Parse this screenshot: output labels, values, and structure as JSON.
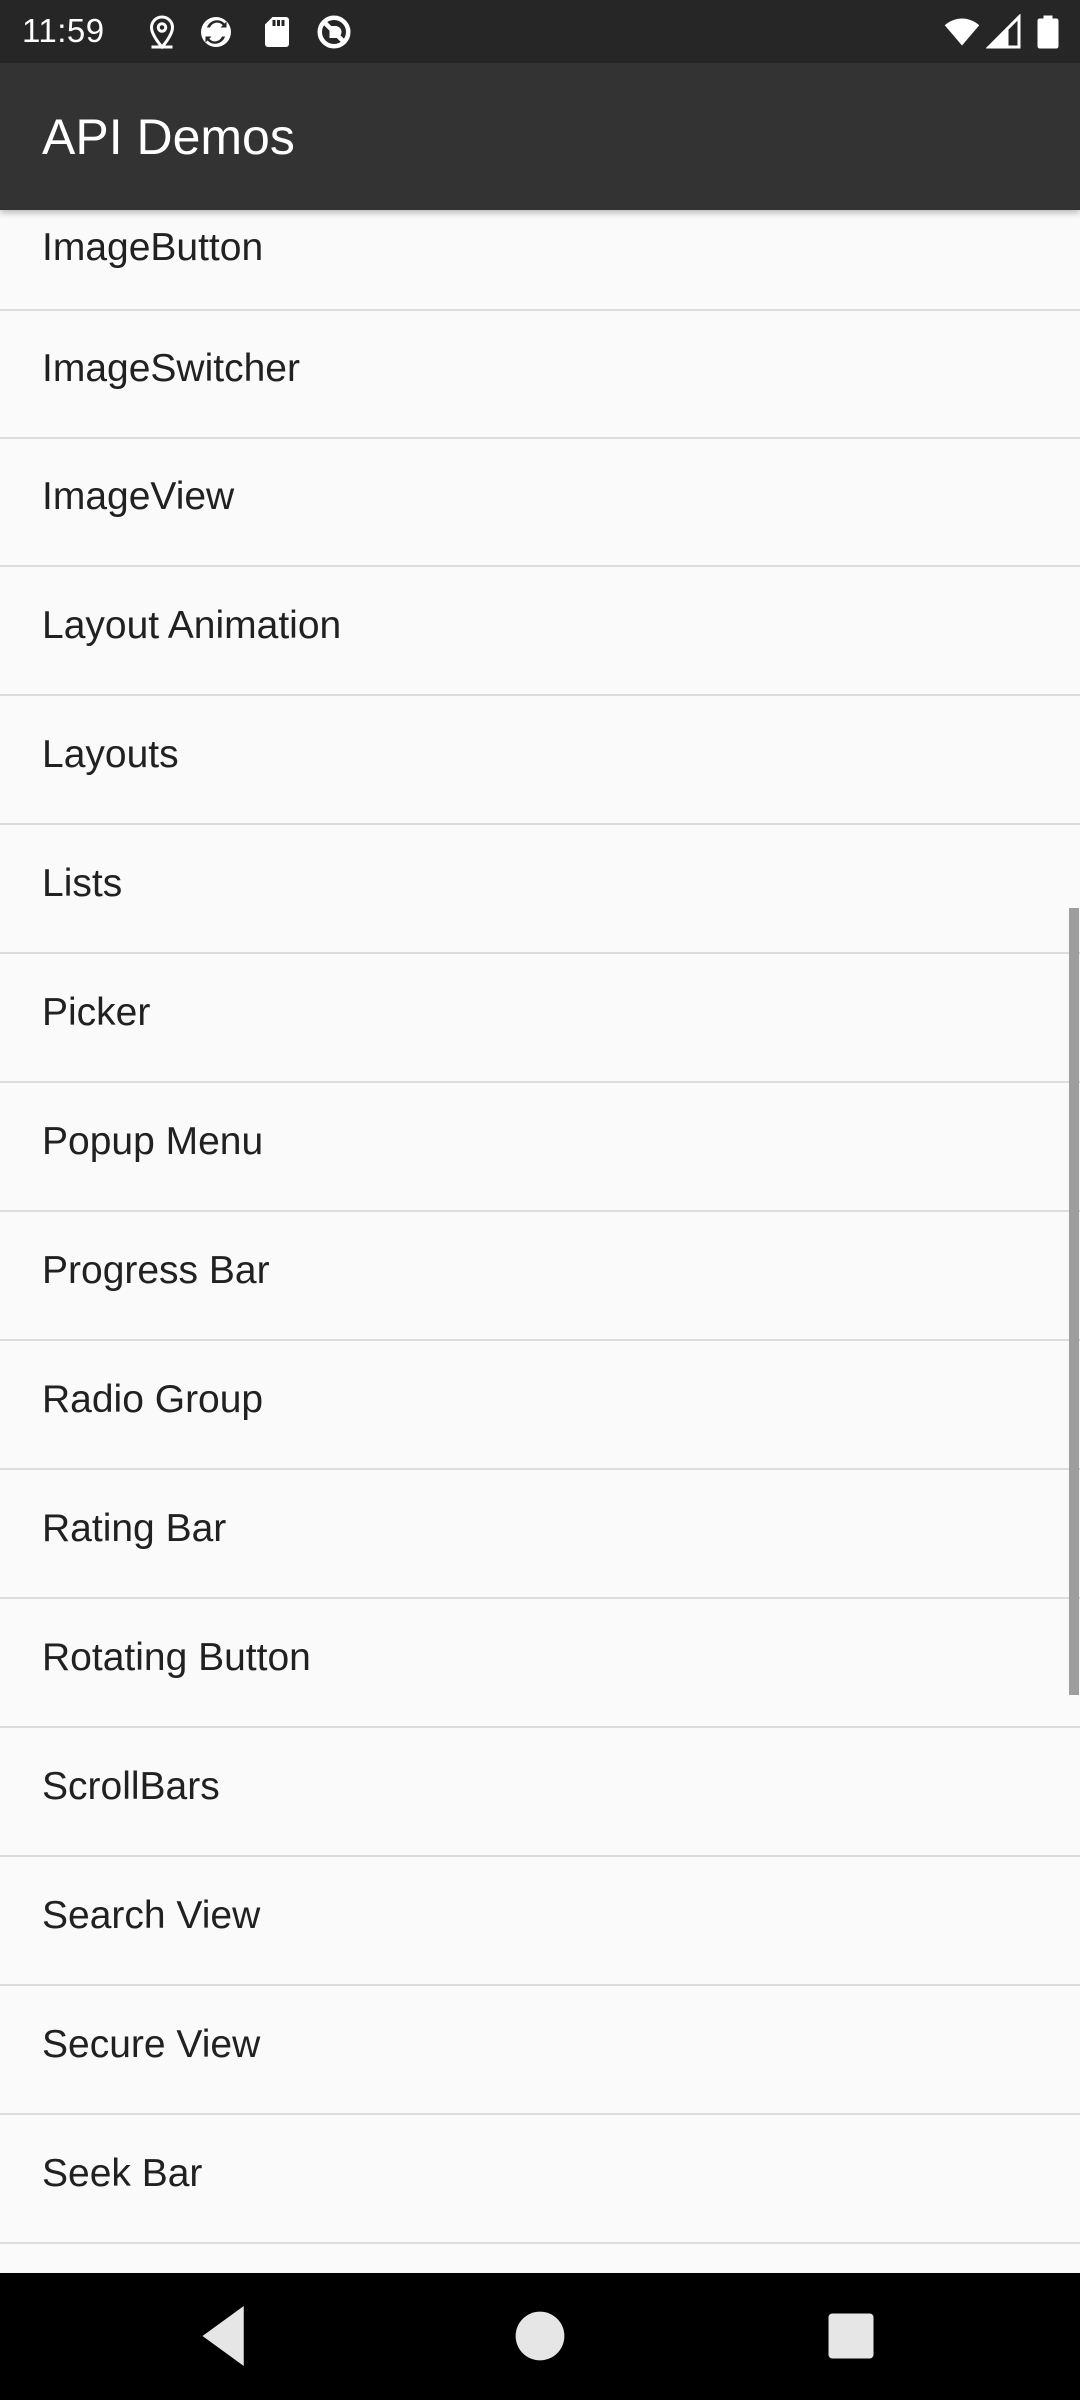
{
  "status_bar": {
    "time": "11:59",
    "left_icons": [
      "location-icon",
      "sync-icon",
      "sd-card-icon",
      "no-disturb-icon"
    ],
    "right_icons": [
      "wifi-icon",
      "signal-icon",
      "battery-icon"
    ]
  },
  "app_bar": {
    "title": "API Demos"
  },
  "list": {
    "items": [
      {
        "label": "ImageButton"
      },
      {
        "label": "ImageSwitcher"
      },
      {
        "label": "ImageView"
      },
      {
        "label": "Layout Animation"
      },
      {
        "label": "Layouts"
      },
      {
        "label": "Lists"
      },
      {
        "label": "Picker"
      },
      {
        "label": "Popup Menu"
      },
      {
        "label": "Progress Bar"
      },
      {
        "label": "Radio Group"
      },
      {
        "label": "Rating Bar"
      },
      {
        "label": "Rotating Button"
      },
      {
        "label": "ScrollBars"
      },
      {
        "label": "Search View"
      },
      {
        "label": "Secure View"
      },
      {
        "label": "Seek Bar"
      },
      {
        "label": ""
      }
    ]
  },
  "nav_bar": {
    "buttons": [
      "back-icon",
      "home-icon",
      "recents-icon"
    ]
  },
  "colors": {
    "status_bar": "#262626",
    "app_bar": "#333333",
    "list_background": "#fafafa",
    "divider": "#dcdcdc",
    "text": "#212121",
    "nav_bar": "#000000"
  }
}
